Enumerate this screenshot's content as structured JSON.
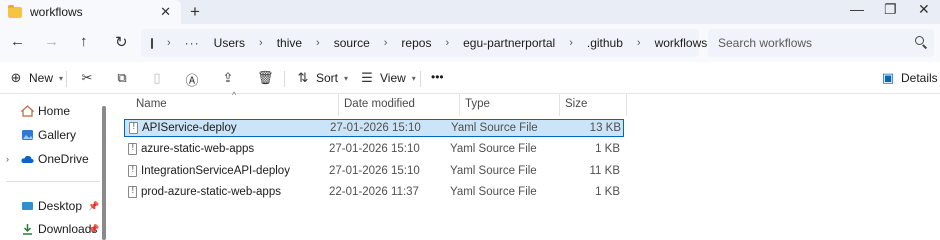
{
  "window": {
    "tab_title": "workflows",
    "tab_close": "✕",
    "new_tab": "+",
    "minimize": "—",
    "maximize": "❐",
    "close": "✕"
  },
  "nav": {
    "back": "←",
    "forward": "→",
    "up": "↑",
    "refresh": "↻",
    "more": "···",
    "breadcrumbs": [
      "Users",
      "thive",
      "source",
      "repos",
      "egu-partnerportal",
      ".github",
      "workflows"
    ],
    "search_placeholder": "Search workflows"
  },
  "commands": {
    "new": "New",
    "sort": "Sort",
    "view": "View",
    "more": "•••",
    "details": "Details"
  },
  "sidebar": {
    "items": [
      {
        "label": "Home",
        "icon": "home-icon"
      },
      {
        "label": "Gallery",
        "icon": "gallery-icon"
      },
      {
        "label": "OneDrive",
        "icon": "onedrive-cloud-icon"
      },
      {
        "label": "Desktop",
        "icon": "desktop-icon"
      },
      {
        "label": "Downloads",
        "icon": "downloads-icon"
      }
    ]
  },
  "columns": {
    "name": "Name",
    "date": "Date modified",
    "type": "Type",
    "size": "Size"
  },
  "files": [
    {
      "name": "APIService-deploy",
      "date": "27-01-2026 15:10",
      "type": "Yaml Source File",
      "size": "13 KB",
      "selected": true
    },
    {
      "name": "azure-static-web-apps",
      "date": "27-01-2026 15:10",
      "type": "Yaml Source File",
      "size": "1 KB",
      "selected": false
    },
    {
      "name": "IntegrationServiceAPI-deploy",
      "date": "27-01-2026 15:10",
      "type": "Yaml Source File",
      "size": "11 KB",
      "selected": false
    },
    {
      "name": "prod-azure-static-web-apps",
      "date": "22-01-2026 11:37",
      "type": "Yaml Source File",
      "size": "1 KB",
      "selected": false
    }
  ],
  "colors": {
    "accent": "#0067c0",
    "selection": "#cce4f7",
    "folder": "#f5c542"
  }
}
